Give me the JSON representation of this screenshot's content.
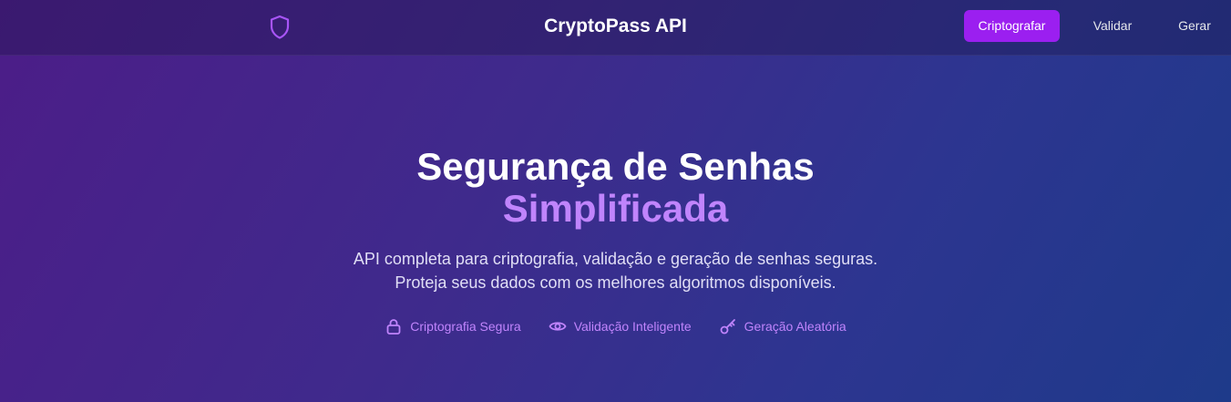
{
  "nav": {
    "brand": "CryptoPass API",
    "logo_icon": "shield-icon",
    "links": [
      {
        "label": "Criptografar",
        "active": true
      },
      {
        "label": "Validar",
        "active": false
      },
      {
        "label": "Gerar",
        "active": false
      }
    ]
  },
  "hero": {
    "title_line1": "Segurança de Senhas",
    "title_line2": "Simplificada",
    "subtitle_line1": "API completa para criptografia, validação e geração de senhas seguras.",
    "subtitle_line2": "Proteja seus dados com os melhores algoritmos disponíveis."
  },
  "features": [
    {
      "icon": "lock-icon",
      "label": "Criptografia Segura"
    },
    {
      "icon": "eye-icon",
      "label": "Validação Inteligente"
    },
    {
      "icon": "key-icon",
      "label": "Geração Aleatória"
    }
  ],
  "colors": {
    "accent": "#c084fc",
    "active_button": "#9b1ff0"
  }
}
